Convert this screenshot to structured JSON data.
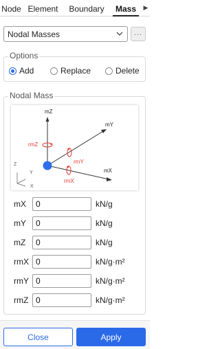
{
  "tabs": [
    {
      "label": "Node",
      "active": false
    },
    {
      "label": "Element",
      "active": false
    },
    {
      "label": "Boundary",
      "active": false
    },
    {
      "label": "Mass",
      "active": true
    }
  ],
  "tab_scroll_icon": "chevron-right-icon",
  "type_select": {
    "value": "Nodal Masses",
    "more_label": "..."
  },
  "options": {
    "title": "Options",
    "radios": [
      {
        "label": "Add",
        "checked": true
      },
      {
        "label": "Replace",
        "checked": false
      },
      {
        "label": "Delete",
        "checked": false
      }
    ]
  },
  "nodal_mass": {
    "title": "Nodal Mass",
    "diagram": {
      "axis_labels": {
        "z": "mZ",
        "y": "mY",
        "x": "mX"
      },
      "rotation_labels": {
        "rz": "rmZ",
        "ry": "rmY",
        "rx": "rmX"
      },
      "triad_labels": {
        "z": "Z",
        "y": "Y",
        "x": "X"
      },
      "colors": {
        "node": "#2f6fea",
        "rotation": "#e53935",
        "axis": "#333333"
      }
    },
    "fields": [
      {
        "label": "mX",
        "value": "0",
        "unit": "kN/g"
      },
      {
        "label": "mY",
        "value": "0",
        "unit": "kN/g"
      },
      {
        "label": "mZ",
        "value": "0",
        "unit": "kN/g"
      },
      {
        "label": "rmX",
        "value": "0",
        "unit": "kN/g·m²"
      },
      {
        "label": "rmY",
        "value": "0",
        "unit": "kN/g·m²"
      },
      {
        "label": "rmZ",
        "value": "0",
        "unit": "kN/g·m²"
      }
    ]
  },
  "buttons": {
    "close": "Close",
    "apply": "Apply"
  },
  "colors": {
    "accent": "#2a6ae8",
    "border": "#9a9a9a"
  }
}
